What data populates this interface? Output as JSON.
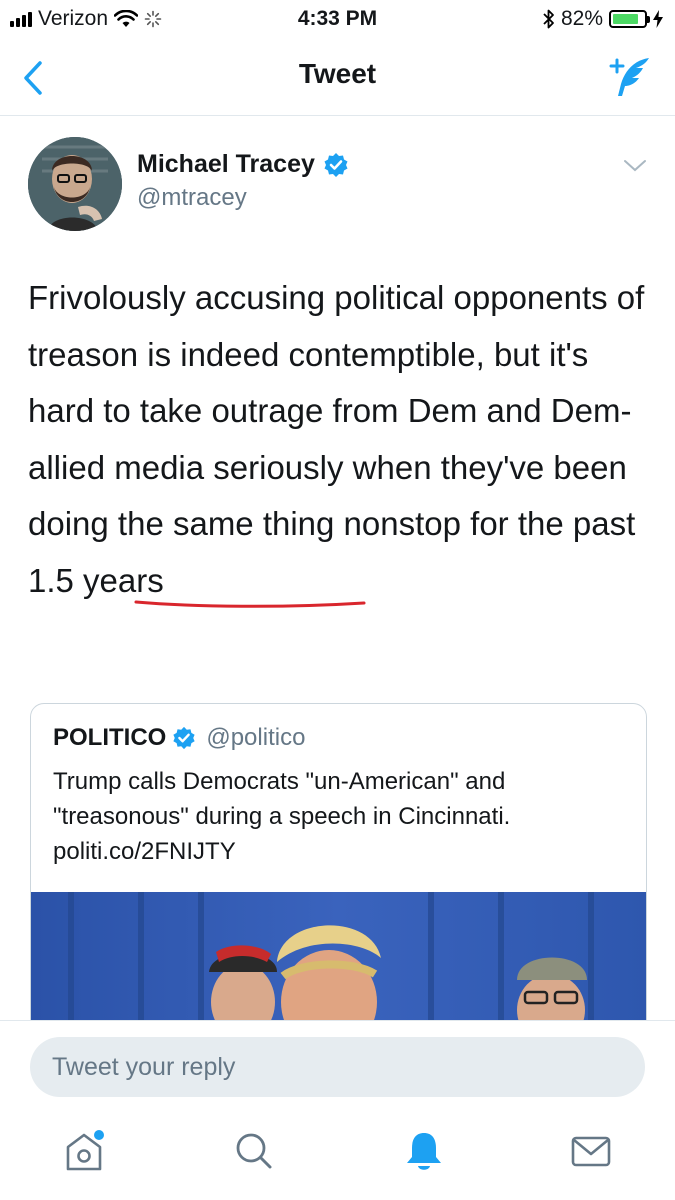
{
  "status_bar": {
    "carrier": "Verizon",
    "time": "4:33 PM",
    "battery_percent": "82%",
    "battery_level": 0.82,
    "icons": [
      "signal-bars-icon",
      "wifi-icon",
      "activity-spinner-icon",
      "bluetooth-icon",
      "battery-icon",
      "charging-bolt-icon"
    ]
  },
  "nav": {
    "title": "Tweet",
    "back_icon": "back-chevron-icon",
    "compose_icon": "compose-tweet-icon"
  },
  "tweet": {
    "author_name": "Michael Tracey",
    "author_handle": "@mtracey",
    "verified": true,
    "text_before": "Frivolously accusing political opponents of treason is indeed contemptible, but it's hard to take outrage from Dem and Dem-allied media seriously when they've been doing ",
    "text_highlight": "the same thing",
    "text_after": " nonstop for the past 1.5 years"
  },
  "quoted_tweet": {
    "author_name": "POLITICO",
    "author_handle": "@politico",
    "verified": true,
    "text": "Trump calls Democrats \"un-American\" and \"treasonous\" during a speech in Cincinnati.",
    "link": "politi.co/2FNIJTY"
  },
  "reply": {
    "placeholder": "Tweet your reply"
  },
  "tabs": [
    {
      "name": "home",
      "icon": "home-icon",
      "active": false,
      "has_dot": true
    },
    {
      "name": "search",
      "icon": "search-icon",
      "active": false
    },
    {
      "name": "notifications",
      "icon": "bell-icon",
      "active": true
    },
    {
      "name": "messages",
      "icon": "envelope-icon",
      "active": false
    }
  ],
  "colors": {
    "accent": "#1da1f2",
    "handle_gray": "#657786",
    "underline_red": "#d9262d"
  }
}
